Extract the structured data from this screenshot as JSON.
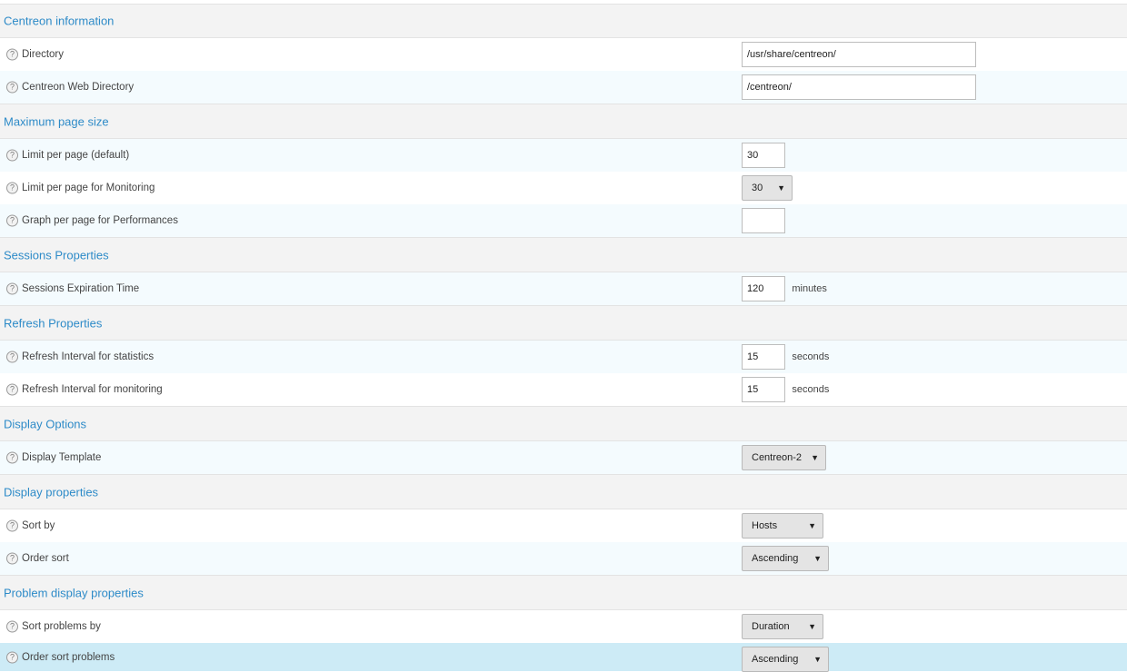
{
  "sections": {
    "centreon_info": {
      "title": "Centreon information",
      "directory": {
        "label": "Directory",
        "value": "/usr/share/centreon/"
      },
      "web_directory": {
        "label": "Centreon Web Directory",
        "value": "/centreon/"
      }
    },
    "page_size": {
      "title": "Maximum page size",
      "limit_default": {
        "label": "Limit per page (default)",
        "value": "30"
      },
      "limit_monitoring": {
        "label": "Limit per page for Monitoring",
        "value": "30"
      },
      "graph_per_page": {
        "label": "Graph per page for Performances",
        "value": ""
      }
    },
    "sessions": {
      "title": "Sessions Properties",
      "expiration": {
        "label": "Sessions Expiration Time",
        "value": "120",
        "unit": "minutes"
      }
    },
    "refresh": {
      "title": "Refresh Properties",
      "statistics": {
        "label": "Refresh Interval for statistics",
        "value": "15",
        "unit": "seconds"
      },
      "monitoring": {
        "label": "Refresh Interval for monitoring",
        "value": "15",
        "unit": "seconds"
      }
    },
    "display_options": {
      "title": "Display Options",
      "template": {
        "label": "Display Template",
        "value": "Centreon-2"
      }
    },
    "display_properties": {
      "title": "Display properties",
      "sort_by": {
        "label": "Sort by",
        "value": "Hosts"
      },
      "order_sort": {
        "label": "Order sort",
        "value": "Ascending"
      }
    },
    "problem_display": {
      "title": "Problem display properties",
      "sort_problems_by": {
        "label": "Sort problems by",
        "value": "Duration"
      },
      "order_sort_problems": {
        "label": "Order sort problems",
        "value": "Ascending"
      }
    }
  },
  "ui": {
    "help_glyph": "?",
    "dropdown_arrow": "▼",
    "icons": [
      "help-icon",
      "chevron-down-icon"
    ],
    "colors": {
      "section_title": "#2e8bc8",
      "header_bg": "#f3f3f3",
      "odd_row_bg": "#f4fbfe",
      "selected_row_bg": "#cdebf6"
    }
  }
}
